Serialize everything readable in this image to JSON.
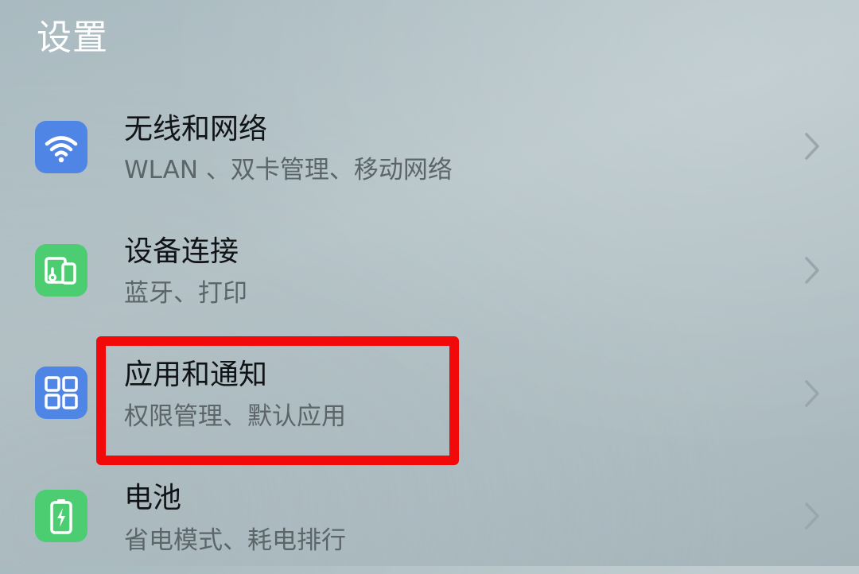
{
  "page": {
    "title": "设置"
  },
  "settings": {
    "items": [
      {
        "title": "无线和网络",
        "subtitle": "WLAN 、双卡管理、移动网络",
        "icon": "wifi-icon",
        "icon_color": "#4f86e6"
      },
      {
        "title": "设备连接",
        "subtitle": "蓝牙、打印",
        "icon": "device-connection-icon",
        "icon_color": "#4ccd72"
      },
      {
        "title": "应用和通知",
        "subtitle": "权限管理、默认应用",
        "icon": "apps-grid-icon",
        "icon_color": "#4f86e6"
      },
      {
        "title": "电池",
        "subtitle": "省电模式、耗电排行",
        "icon": "battery-icon",
        "icon_color": "#4ccd72"
      }
    ]
  },
  "highlight": {
    "color": "#f20a0a",
    "target": "应用和通知"
  }
}
